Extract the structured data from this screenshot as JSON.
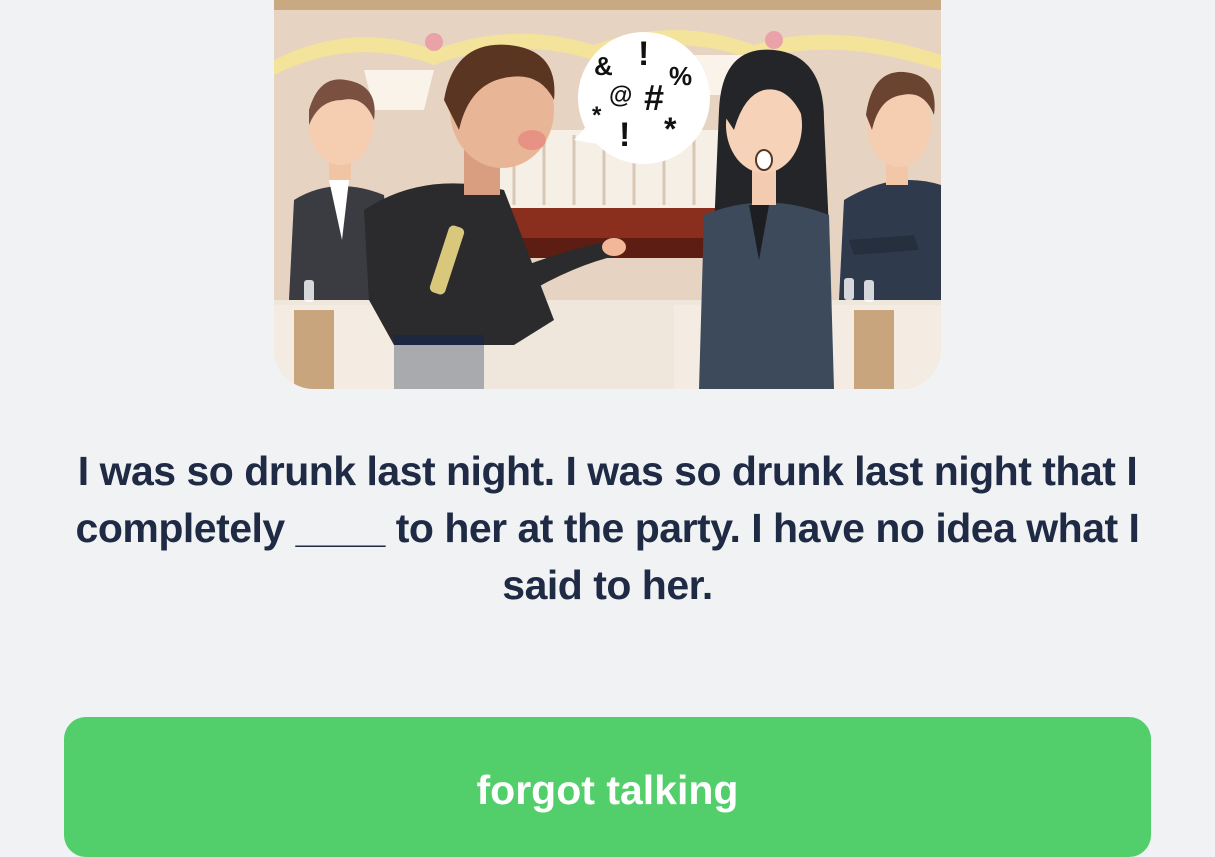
{
  "illustration": {
    "speech_symbols": [
      "&",
      "!",
      "%",
      "@",
      "#",
      "*",
      "!",
      "*"
    ]
  },
  "question": {
    "text": "I was so drunk last night. I was so drunk last night that I completely ____ to her at the party. I have no idea what I said to her."
  },
  "answer": {
    "label": "forgot talking"
  },
  "colors": {
    "background": "#f1f2f4",
    "question_text": "#1f2b45",
    "answer_button": "#52cf6a",
    "answer_text": "#ffffff"
  }
}
